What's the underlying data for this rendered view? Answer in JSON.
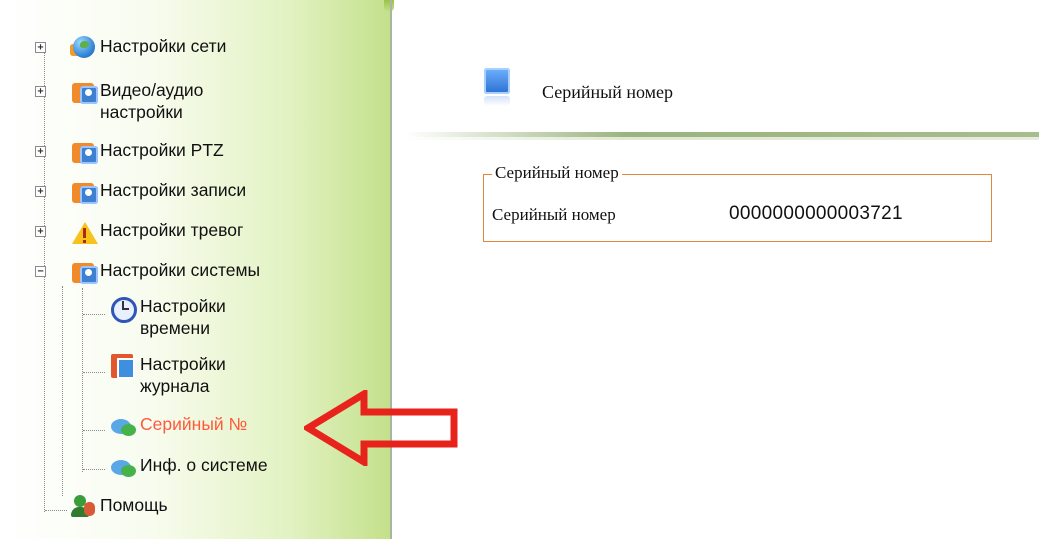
{
  "sidebar": {
    "items": [
      {
        "label": "Настройки сети",
        "icon": "network-globe-icon",
        "expander": "+"
      },
      {
        "label": "Видео/аудио настройки",
        "icon": "video-audio-icon",
        "expander": "+"
      },
      {
        "label": "Настройки PTZ",
        "icon": "ptz-icon",
        "expander": "+"
      },
      {
        "label": "Настройки записи",
        "icon": "record-icon",
        "expander": "+"
      },
      {
        "label": "Настройки тревог",
        "icon": "warning-icon",
        "expander": "+"
      },
      {
        "label": "Настройки системы",
        "icon": "system-icon",
        "expander": "−"
      }
    ],
    "system_children": [
      {
        "label": "Настройки времени",
        "icon": "clock-icon"
      },
      {
        "label": "Настройки журнала",
        "icon": "journal-icon"
      },
      {
        "label": "Серийный №",
        "icon": "serial-icon",
        "active": true
      },
      {
        "label": "Инф. о системе",
        "icon": "system-info-icon"
      }
    ],
    "help": {
      "label": "Помощь",
      "icon": "help-icon"
    }
  },
  "main": {
    "title": "Серийный номер",
    "group_legend": "Серийный номер",
    "serial_label": "Серийный номер",
    "serial_value": "0000000000003721"
  },
  "colors": {
    "active_item": "#ff5a3c",
    "group_border": "#e1873d",
    "arrow": "#e8231c",
    "sidebar_green": "#c3e08a"
  }
}
